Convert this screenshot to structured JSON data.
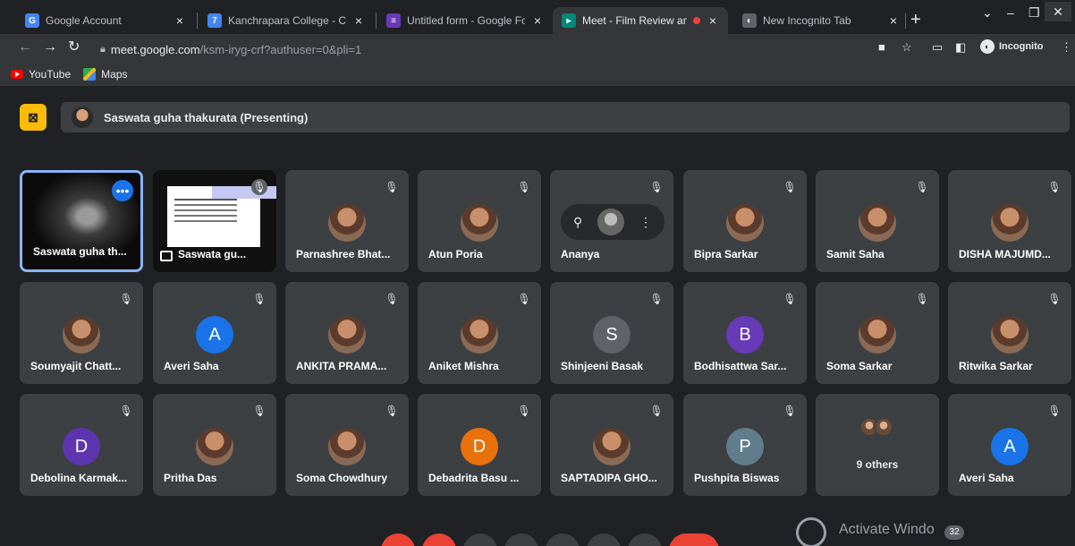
{
  "browser": {
    "tabs": [
      {
        "title": "Google Account",
        "favicon": "google-icon",
        "color": "#4285f4"
      },
      {
        "title": "Kanchrapara College - Calenda",
        "favicon": "calendar-icon",
        "color": "#4285f4"
      },
      {
        "title": "Untitled form - Google Forms",
        "favicon": "forms-icon",
        "color": "#673ab7"
      },
      {
        "title": "Meet - Film Review and Ap",
        "favicon": "meet-icon",
        "color": "#00897b"
      },
      {
        "title": "New Incognito Tab",
        "favicon": "incognito-icon",
        "color": "#9aa0a6"
      }
    ],
    "new_tab": "+",
    "url_host": "meet.google.com",
    "url_path": "/ksm-iryg-crf?authuser=0&pli=1",
    "incognito_label": "Incognito",
    "bookmarks": [
      {
        "label": "YouTube",
        "icon": "youtube-icon"
      },
      {
        "label": "Maps",
        "icon": "maps-icon"
      }
    ]
  },
  "meet": {
    "presenting_label": "Saswata guha thakurata (Presenting)",
    "participants": [
      {
        "name": "Saswata guha th...",
        "type": "self-video"
      },
      {
        "name": "Saswata gu...",
        "type": "screen-share"
      },
      {
        "name": "Parnashree Bhat...",
        "type": "photo"
      },
      {
        "name": "Atun Poria",
        "type": "photo"
      },
      {
        "name": "Ananya",
        "type": "hover"
      },
      {
        "name": "Bipra Sarkar",
        "type": "photo"
      },
      {
        "name": "Samit Saha",
        "type": "photo"
      },
      {
        "name": "DISHA MAJUMD...",
        "type": "photo"
      },
      {
        "name": "Soumyajit Chatt...",
        "type": "photo"
      },
      {
        "name": "Averi Saha",
        "type": "initial",
        "initial": "A",
        "color": "#1a73e8"
      },
      {
        "name": "ANKITA PRAMA...",
        "type": "photo"
      },
      {
        "name": "Aniket Mishra",
        "type": "photo"
      },
      {
        "name": "Shinjeeni Basak",
        "type": "initial",
        "initial": "S",
        "color": "#5f6368"
      },
      {
        "name": "Bodhisattwa Sar...",
        "type": "initial",
        "initial": "B",
        "color": "#673ab7"
      },
      {
        "name": "Soma Sarkar",
        "type": "photo"
      },
      {
        "name": "Ritwika Sarkar",
        "type": "photo"
      },
      {
        "name": "Debolina Karmak...",
        "type": "initial",
        "initial": "D",
        "color": "#5e35b1"
      },
      {
        "name": "Pritha Das",
        "type": "photo"
      },
      {
        "name": "Soma Chowdhury",
        "type": "photo"
      },
      {
        "name": "Debadrita Basu ...",
        "type": "initial",
        "initial": "D",
        "color": "#e8710a"
      },
      {
        "name": "SAPTADIPA GHO...",
        "type": "photo"
      },
      {
        "name": "Pushpita Biswas",
        "type": "initial",
        "initial": "P",
        "color": "#607d8b"
      },
      {
        "name": "9 others",
        "type": "others"
      },
      {
        "name": "Averi Saha",
        "type": "initial",
        "initial": "A",
        "color": "#1a73e8"
      }
    ],
    "participant_count": "32"
  },
  "watermark": "Activate Windo"
}
